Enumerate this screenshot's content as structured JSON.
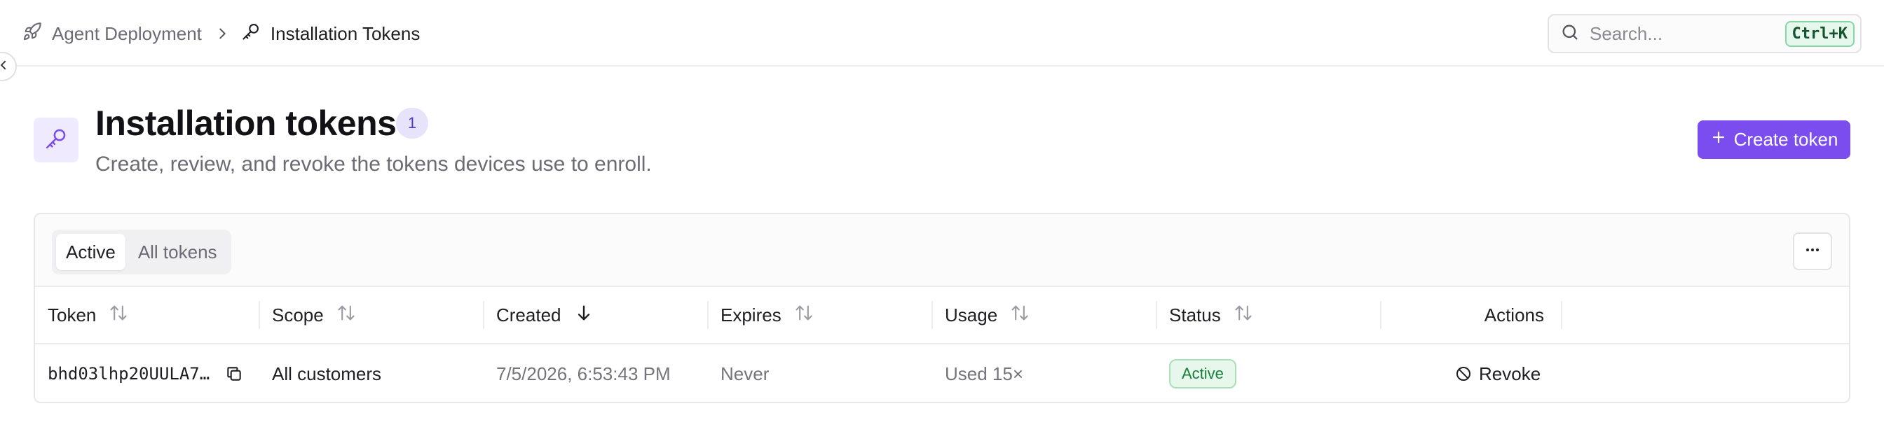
{
  "breadcrumb": {
    "parent": "Agent Deployment",
    "current": "Installation Tokens"
  },
  "search": {
    "placeholder": "Search...",
    "shortcut": "Ctrl+K"
  },
  "page": {
    "title": "Installation tokens",
    "count": "1",
    "subtitle": "Create, review, and revoke the tokens devices use to enroll.",
    "create_label": "Create token"
  },
  "filters": {
    "tabs": [
      {
        "label": "Active",
        "selected": true
      },
      {
        "label": "All tokens",
        "selected": false
      }
    ]
  },
  "table": {
    "columns": [
      {
        "label": "Token",
        "sort": "none"
      },
      {
        "label": "Scope",
        "sort": "none"
      },
      {
        "label": "Created",
        "sort": "descending"
      },
      {
        "label": "Expires",
        "sort": "none"
      },
      {
        "label": "Usage",
        "sort": "none"
      },
      {
        "label": "Status",
        "sort": "none"
      },
      {
        "label": "Actions"
      }
    ],
    "rows": [
      {
        "token": "bhd03lhp20UULA7…",
        "scope": "All customers",
        "created": "7/5/2026, 6:53:43 PM",
        "expires": "Never",
        "usage": "Used 15×",
        "status": "Active",
        "action": "Revoke"
      }
    ]
  },
  "colors": {
    "accent": "#7c4dee",
    "status_active_bg": "#e8f7ec",
    "status_active_text": "#16803c"
  },
  "icons": {
    "breadcrumb_parent": "rocket-icon",
    "breadcrumb_current": "key-icon",
    "search": "search-icon",
    "hero": "key-icon",
    "copy": "copy-icon",
    "revoke": "ban-icon",
    "more": "ellipsis-icon"
  }
}
